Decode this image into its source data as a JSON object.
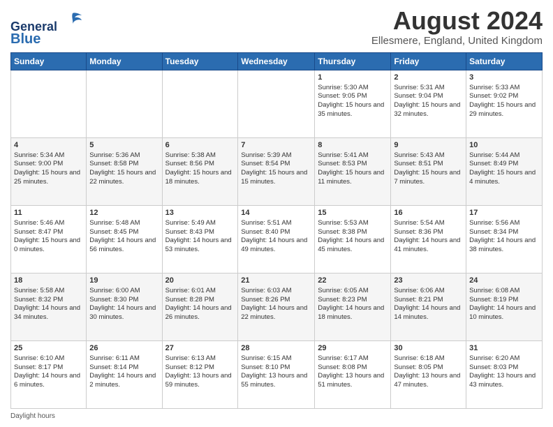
{
  "logo": {
    "line1": "General",
    "line2": "Blue"
  },
  "title": "August 2024",
  "subtitle": "Ellesmere, England, United Kingdom",
  "days_of_week": [
    "Sunday",
    "Monday",
    "Tuesday",
    "Wednesday",
    "Thursday",
    "Friday",
    "Saturday"
  ],
  "footer": {
    "label": "Daylight hours"
  },
  "weeks": [
    [
      {
        "day": "",
        "info": ""
      },
      {
        "day": "",
        "info": ""
      },
      {
        "day": "",
        "info": ""
      },
      {
        "day": "",
        "info": ""
      },
      {
        "day": "1",
        "info": "Sunrise: 5:30 AM\nSunset: 9:05 PM\nDaylight: 15 hours and 35 minutes."
      },
      {
        "day": "2",
        "info": "Sunrise: 5:31 AM\nSunset: 9:04 PM\nDaylight: 15 hours and 32 minutes."
      },
      {
        "day": "3",
        "info": "Sunrise: 5:33 AM\nSunset: 9:02 PM\nDaylight: 15 hours and 29 minutes."
      }
    ],
    [
      {
        "day": "4",
        "info": "Sunrise: 5:34 AM\nSunset: 9:00 PM\nDaylight: 15 hours and 25 minutes."
      },
      {
        "day": "5",
        "info": "Sunrise: 5:36 AM\nSunset: 8:58 PM\nDaylight: 15 hours and 22 minutes."
      },
      {
        "day": "6",
        "info": "Sunrise: 5:38 AM\nSunset: 8:56 PM\nDaylight: 15 hours and 18 minutes."
      },
      {
        "day": "7",
        "info": "Sunrise: 5:39 AM\nSunset: 8:54 PM\nDaylight: 15 hours and 15 minutes."
      },
      {
        "day": "8",
        "info": "Sunrise: 5:41 AM\nSunset: 8:53 PM\nDaylight: 15 hours and 11 minutes."
      },
      {
        "day": "9",
        "info": "Sunrise: 5:43 AM\nSunset: 8:51 PM\nDaylight: 15 hours and 7 minutes."
      },
      {
        "day": "10",
        "info": "Sunrise: 5:44 AM\nSunset: 8:49 PM\nDaylight: 15 hours and 4 minutes."
      }
    ],
    [
      {
        "day": "11",
        "info": "Sunrise: 5:46 AM\nSunset: 8:47 PM\nDaylight: 15 hours and 0 minutes."
      },
      {
        "day": "12",
        "info": "Sunrise: 5:48 AM\nSunset: 8:45 PM\nDaylight: 14 hours and 56 minutes."
      },
      {
        "day": "13",
        "info": "Sunrise: 5:49 AM\nSunset: 8:43 PM\nDaylight: 14 hours and 53 minutes."
      },
      {
        "day": "14",
        "info": "Sunrise: 5:51 AM\nSunset: 8:40 PM\nDaylight: 14 hours and 49 minutes."
      },
      {
        "day": "15",
        "info": "Sunrise: 5:53 AM\nSunset: 8:38 PM\nDaylight: 14 hours and 45 minutes."
      },
      {
        "day": "16",
        "info": "Sunrise: 5:54 AM\nSunset: 8:36 PM\nDaylight: 14 hours and 41 minutes."
      },
      {
        "day": "17",
        "info": "Sunrise: 5:56 AM\nSunset: 8:34 PM\nDaylight: 14 hours and 38 minutes."
      }
    ],
    [
      {
        "day": "18",
        "info": "Sunrise: 5:58 AM\nSunset: 8:32 PM\nDaylight: 14 hours and 34 minutes."
      },
      {
        "day": "19",
        "info": "Sunrise: 6:00 AM\nSunset: 8:30 PM\nDaylight: 14 hours and 30 minutes."
      },
      {
        "day": "20",
        "info": "Sunrise: 6:01 AM\nSunset: 8:28 PM\nDaylight: 14 hours and 26 minutes."
      },
      {
        "day": "21",
        "info": "Sunrise: 6:03 AM\nSunset: 8:26 PM\nDaylight: 14 hours and 22 minutes."
      },
      {
        "day": "22",
        "info": "Sunrise: 6:05 AM\nSunset: 8:23 PM\nDaylight: 14 hours and 18 minutes."
      },
      {
        "day": "23",
        "info": "Sunrise: 6:06 AM\nSunset: 8:21 PM\nDaylight: 14 hours and 14 minutes."
      },
      {
        "day": "24",
        "info": "Sunrise: 6:08 AM\nSunset: 8:19 PM\nDaylight: 14 hours and 10 minutes."
      }
    ],
    [
      {
        "day": "25",
        "info": "Sunrise: 6:10 AM\nSunset: 8:17 PM\nDaylight: 14 hours and 6 minutes."
      },
      {
        "day": "26",
        "info": "Sunrise: 6:11 AM\nSunset: 8:14 PM\nDaylight: 14 hours and 2 minutes."
      },
      {
        "day": "27",
        "info": "Sunrise: 6:13 AM\nSunset: 8:12 PM\nDaylight: 13 hours and 59 minutes."
      },
      {
        "day": "28",
        "info": "Sunrise: 6:15 AM\nSunset: 8:10 PM\nDaylight: 13 hours and 55 minutes."
      },
      {
        "day": "29",
        "info": "Sunrise: 6:17 AM\nSunset: 8:08 PM\nDaylight: 13 hours and 51 minutes."
      },
      {
        "day": "30",
        "info": "Sunrise: 6:18 AM\nSunset: 8:05 PM\nDaylight: 13 hours and 47 minutes."
      },
      {
        "day": "31",
        "info": "Sunrise: 6:20 AM\nSunset: 8:03 PM\nDaylight: 13 hours and 43 minutes."
      }
    ]
  ]
}
